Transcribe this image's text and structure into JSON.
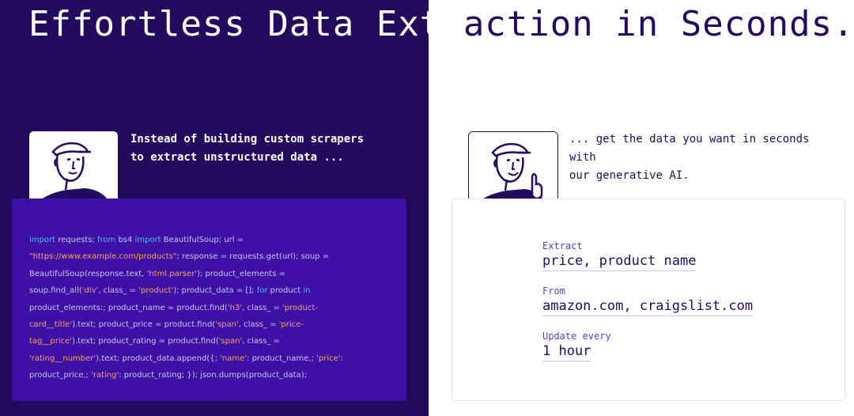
{
  "headline": {
    "part_light": "Effortless Data Extr",
    "part_dark": "action in Seconds."
  },
  "left": {
    "caption_line1": "Instead of building custom scrapers",
    "caption_line2": "to extract unstructured data ...",
    "code_lines": [
      [
        [
          "kw",
          "import"
        ],
        [
          "t",
          " requests; "
        ],
        [
          "kw",
          "from"
        ],
        [
          "t",
          " bs4 "
        ],
        [
          "kw",
          "import"
        ],
        [
          "t",
          " BeautifulSoup; url ="
        ]
      ],
      [
        [
          "str",
          "\"https://www.example.com/products\""
        ],
        [
          "t",
          "; response = requests.get(url); soup ="
        ]
      ],
      [
        [
          "t",
          "BeautifulSoup(response.text, "
        ],
        [
          "str",
          "'html.parser'"
        ],
        [
          "t",
          "); product_elements ="
        ]
      ],
      [
        [
          "t",
          "soup.find_all("
        ],
        [
          "str",
          "'div'"
        ],
        [
          "t",
          ", class_ = "
        ],
        [
          "str",
          "'product'"
        ],
        [
          "t",
          "); product_data = []; "
        ],
        [
          "kw",
          "for"
        ],
        [
          "t",
          " product "
        ],
        [
          "kw",
          "in"
        ]
      ],
      [
        [
          "t",
          "product_elements:; product_name = product.find("
        ],
        [
          "str",
          "'h3'"
        ],
        [
          "t",
          ", class_ = "
        ],
        [
          "str",
          "'product-"
        ]
      ],
      [
        [
          "str",
          "card__title'"
        ],
        [
          "t",
          ").text; product_price = product.find("
        ],
        [
          "str",
          "'span'"
        ],
        [
          "t",
          ", class_ = "
        ],
        [
          "str",
          "'price-"
        ]
      ],
      [
        [
          "str",
          "tag__price'"
        ],
        [
          "t",
          ").text; product_rating = product.find("
        ],
        [
          "str",
          "'span'"
        ],
        [
          "t",
          ", class_ ="
        ]
      ],
      [
        [
          "str",
          "'rating__number'"
        ],
        [
          "t",
          ").text; product_data.append({; "
        ],
        [
          "str",
          "'name'"
        ],
        [
          "t",
          ": product_name,; "
        ],
        [
          "str",
          "'price'"
        ],
        [
          "t",
          ":"
        ]
      ],
      [
        [
          "t",
          "product_price,; "
        ],
        [
          "str",
          "'rating'"
        ],
        [
          "t",
          ": product_rating; }); json.dumps(product_data);"
        ]
      ]
    ]
  },
  "right": {
    "caption_line1": "... get the data you want in seconds with",
    "caption_line2": "our generative AI.",
    "fields": {
      "extract_label": "Extract",
      "extract_value": "price, product name",
      "from_label": "From",
      "from_value": "amazon.com, craigslist.com",
      "update_label": "Update every",
      "update_value": "1 hour"
    }
  },
  "colors": {
    "dark_purple": "#230a5c",
    "code_panel": "#3d10a6",
    "keyword": "#4fb8f0",
    "string": "#f5a25a",
    "accent_label": "#5a3ad8"
  }
}
